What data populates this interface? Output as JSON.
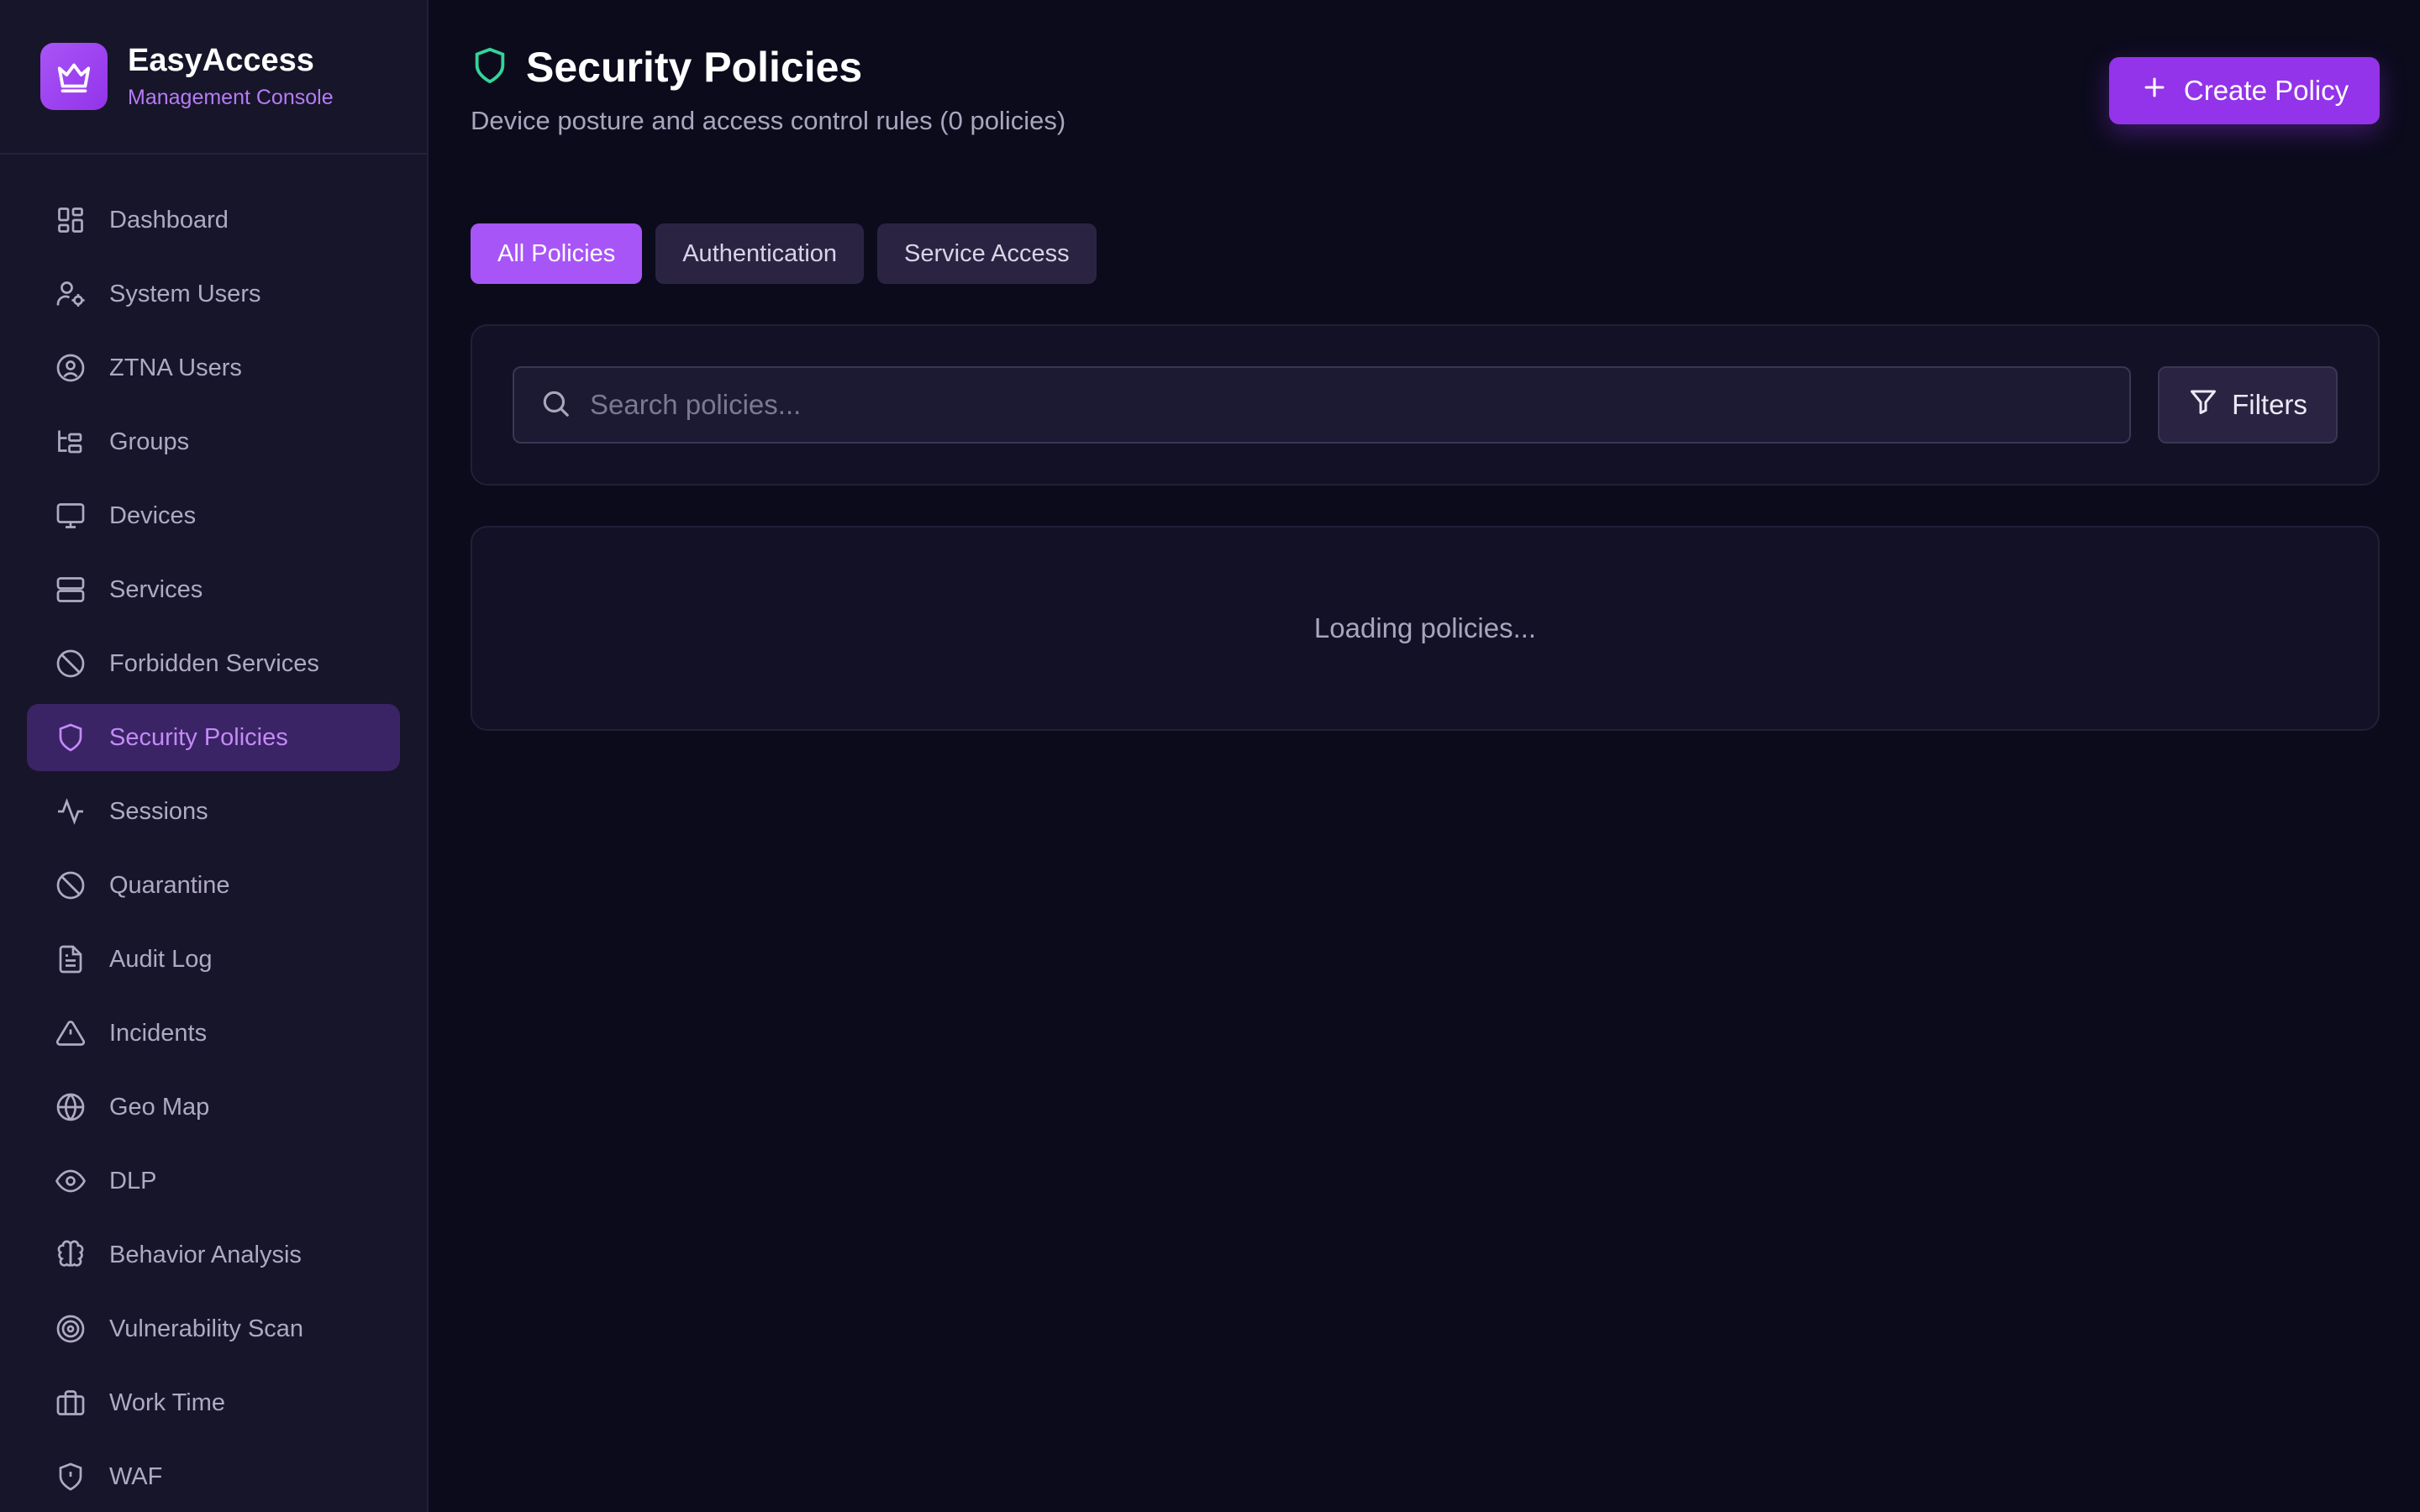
{
  "brand": {
    "title": "EasyAccess",
    "subtitle": "Management Console",
    "logo_icon": "crown-icon"
  },
  "sidebar": {
    "items": [
      {
        "label": "Dashboard",
        "icon": "dashboard-icon"
      },
      {
        "label": "System Users",
        "icon": "user-cog-icon"
      },
      {
        "label": "ZTNA Users",
        "icon": "user-circle-icon"
      },
      {
        "label": "Groups",
        "icon": "folder-tree-icon"
      },
      {
        "label": "Devices",
        "icon": "monitor-icon"
      },
      {
        "label": "Services",
        "icon": "server-icon"
      },
      {
        "label": "Forbidden Services",
        "icon": "ban-icon"
      },
      {
        "label": "Security Policies",
        "icon": "shield-icon",
        "active": true
      },
      {
        "label": "Sessions",
        "icon": "activity-icon"
      },
      {
        "label": "Quarantine",
        "icon": "ban-icon"
      },
      {
        "label": "Audit Log",
        "icon": "file-text-icon"
      },
      {
        "label": "Incidents",
        "icon": "alert-triangle-icon"
      },
      {
        "label": "Geo Map",
        "icon": "globe-icon"
      },
      {
        "label": "DLP",
        "icon": "eye-icon"
      },
      {
        "label": "Behavior Analysis",
        "icon": "brain-icon"
      },
      {
        "label": "Vulnerability Scan",
        "icon": "target-icon"
      },
      {
        "label": "Work Time",
        "icon": "briefcase-icon"
      },
      {
        "label": "WAF",
        "icon": "shield-alert-icon"
      }
    ]
  },
  "page": {
    "title": "Security Policies",
    "title_icon": "shield-icon",
    "subtitle": "Device posture and access control rules (0 policies)",
    "create_button": "Create Policy"
  },
  "tabs": [
    {
      "label": "All Policies",
      "active": true
    },
    {
      "label": "Authentication",
      "active": false
    },
    {
      "label": "Service Access",
      "active": false
    }
  ],
  "search": {
    "placeholder": "Search policies...",
    "value": "",
    "filters_label": "Filters"
  },
  "content": {
    "loading_text": "Loading policies..."
  },
  "colors": {
    "accent": "#9333ea",
    "accent_light": "#a855f7",
    "background": "#0c0b1c",
    "sidebar": "#171529",
    "title_icon": "#34d399"
  }
}
